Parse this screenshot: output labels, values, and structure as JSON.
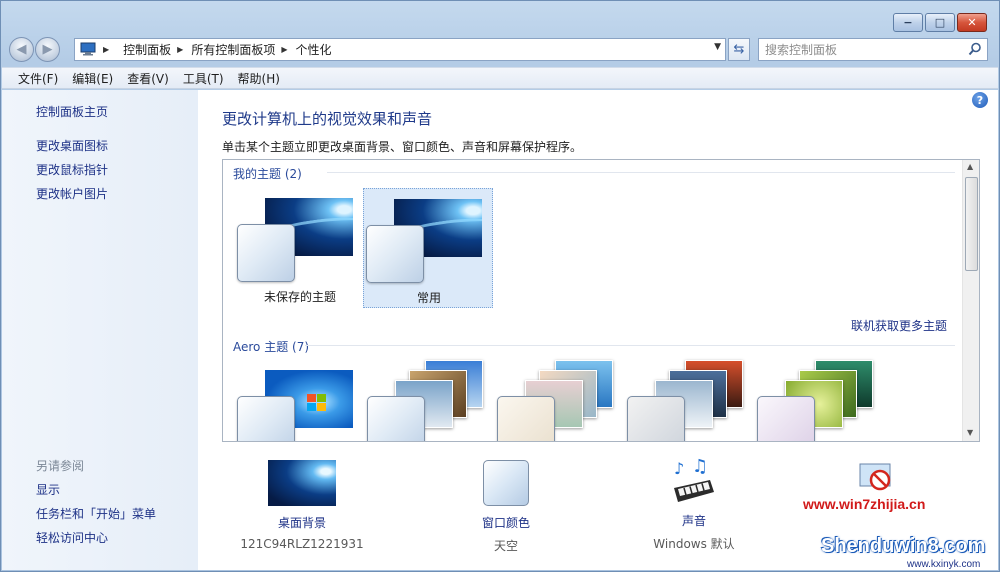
{
  "window": {
    "caption": {
      "minimize": "−",
      "maximize": "□",
      "close": "✕"
    }
  },
  "address": {
    "crumbs": [
      "控制面板",
      "所有控制面板项",
      "个性化"
    ]
  },
  "search": {
    "placeholder": "搜索控制面板"
  },
  "menu": [
    "文件(F)",
    "编辑(E)",
    "查看(V)",
    "工具(T)",
    "帮助(H)"
  ],
  "sidebar": {
    "home": "控制面板主页",
    "links": [
      "更改桌面图标",
      "更改鼠标指针",
      "更改帐户图片"
    ],
    "see_also": "另请参阅",
    "see_also_links": [
      "显示",
      "任务栏和「开始」菜单",
      "轻松访问中心"
    ]
  },
  "main": {
    "title": "更改计算机上的视觉效果和声音",
    "subtitle": "单击某个主题立即更改桌面背景、窗口颜色、声音和屏幕保护程序。",
    "my_themes_label": "我的主题 (2)",
    "my_themes": [
      {
        "name": "未保存的主题"
      },
      {
        "name": "常用",
        "selected": true
      }
    ],
    "more_themes": "联机获取更多主题",
    "aero_label": "Aero 主题 (7)"
  },
  "bottom": [
    {
      "label": "桌面背景",
      "sub": "121C94RLZ1221931"
    },
    {
      "label": "窗口颜色",
      "sub": "天空"
    },
    {
      "label": "声音",
      "sub": "Windows 默认"
    }
  ],
  "watermarks": {
    "site1": "www.win7zhijia.cn",
    "site2": "Shenduwin8.com",
    "site3": "www.kxinyk.com"
  },
  "colors": {
    "link": "#1e3287",
    "title": "#1f3a8a",
    "accent": "#2a4a9b"
  }
}
